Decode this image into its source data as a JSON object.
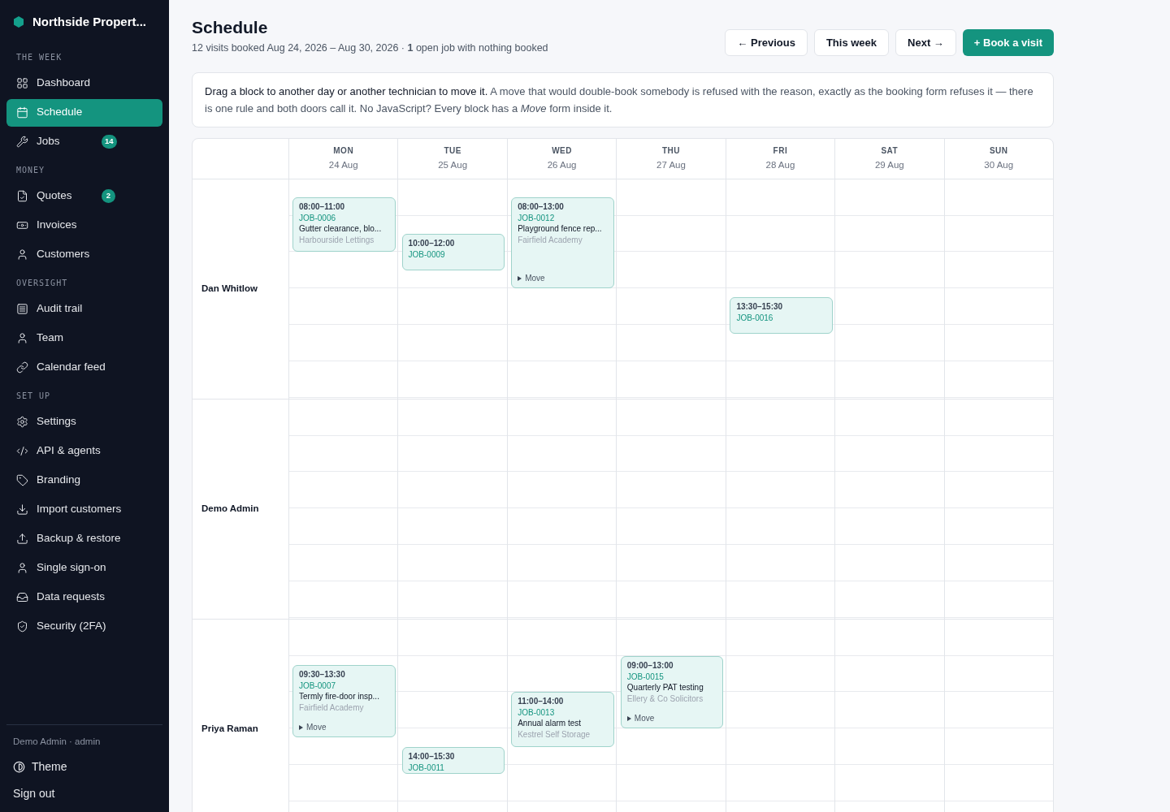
{
  "brand": "Northside Propert...",
  "sidebar": {
    "sections": [
      {
        "label": "THE WEEK",
        "items": [
          {
            "label": "Dashboard",
            "selected": false
          },
          {
            "label": "Schedule",
            "selected": true
          },
          {
            "label": "Jobs",
            "selected": false,
            "badge": "14"
          }
        ]
      },
      {
        "label": "MONEY",
        "items": [
          {
            "label": "Quotes",
            "selected": false,
            "badge": "2"
          },
          {
            "label": "Invoices",
            "selected": false
          },
          {
            "label": "Customers",
            "selected": false
          }
        ]
      },
      {
        "label": "OVERSIGHT",
        "items": [
          {
            "label": "Audit trail",
            "selected": false
          },
          {
            "label": "Team",
            "selected": false
          },
          {
            "label": "Calendar feed",
            "selected": false
          }
        ]
      },
      {
        "label": "SET UP",
        "items": [
          {
            "label": "Settings",
            "selected": false
          },
          {
            "label": "API & agents",
            "selected": false
          },
          {
            "label": "Branding",
            "selected": false
          },
          {
            "label": "Import customers",
            "selected": false
          },
          {
            "label": "Backup & restore",
            "selected": false
          },
          {
            "label": "Single sign-on",
            "selected": false
          },
          {
            "label": "Data requests",
            "selected": false
          },
          {
            "label": "Security (2FA)",
            "selected": false
          }
        ]
      }
    ],
    "user": "Demo Admin · admin",
    "theme": "Theme",
    "sign_out": "Sign out"
  },
  "page": {
    "title": "Schedule",
    "subtitle": "12 visits booked Aug 24, 2026 – Aug 30, 2026 · **1** open job with nothing booked",
    "buttons": [
      {
        "label": "← Previous",
        "kind": "plain"
      },
      {
        "label": "This week",
        "kind": "plain"
      },
      {
        "label": "Next →",
        "kind": "plain"
      },
      {
        "label": "+ Book a visit",
        "kind": "primary"
      }
    ]
  },
  "notice": {
    "lead": "Drag a block to another day or another technician to move it.",
    "body": "A move that would double-book somebody is refused with the reason, exactly as the booking form refuses it — there is one rule and both doors call it. No JavaScript? Every block has a *Move* form inside it."
  },
  "calendar": {
    "days": [
      {
        "name": "MON",
        "date": "24 Aug"
      },
      {
        "name": "TUE",
        "date": "25 Aug"
      },
      {
        "name": "WED",
        "date": "26 Aug"
      },
      {
        "name": "THU",
        "date": "27 Aug"
      },
      {
        "name": "FRI",
        "date": "28 Aug"
      },
      {
        "name": "SAT",
        "date": "29 Aug"
      },
      {
        "name": "SUN",
        "date": "30 Aug"
      }
    ],
    "technicians": [
      {
        "name": "Dan Whitlow",
        "days": [
          {
            "kind": "booked",
            "visits": [
              {
                "time": "08:00–11:00",
                "job": "JOB-0006",
                "title": "Gutter clearance, blo...",
                "customer": "Harbourside Lettings"
              }
            ]
          },
          {
            "kind": "booked",
            "visits": [
              {
                "time": "10:00–12:00",
                "job": "JOB-0009"
              }
            ]
          },
          {
            "kind": "booked",
            "visits": [
              {
                "time": "08:00–13:00",
                "job": "JOB-0012",
                "title": "Playground fence rep...",
                "customer": "Fairfield Academy",
                "move": "Move"
              }
            ]
          },
          {
            "kind": "empty"
          },
          {
            "kind": "booked",
            "visits": [
              {
                "time": "13:30–15:30",
                "job": "JOB-0016"
              }
            ]
          },
          {
            "kind": "empty"
          },
          {
            "kind": "empty"
          }
        ]
      },
      {
        "name": "Demo Admin"
      },
      {
        "name": "Priya Raman",
        "days": [
          {
            "kind": "booked",
            "visits": [
              {
                "time": "09:30–13:30",
                "job": "JOB-0007",
                "title": "Termly fire-door insp...",
                "customer": "Fairfield Academy",
                "move": "Move"
              }
            ]
          },
          {
            "kind": "booked",
            "visits": [
              {
                "time": "14:00–15:30",
                "job": "JOB-0011"
              }
            ]
          },
          {
            "kind": "booked",
            "visits": [
              {
                "time": "11:00–14:00",
                "job": "JOB-0013",
                "title": "Annual alarm test",
                "customer": "Kestrel Self Storage"
              }
            ]
          },
          {
            "kind": "booked",
            "visits": [
              {
                "time": "09:00–13:00",
                "job": "JOB-0015",
                "title": "Quarterly PAT testing",
                "customer": "Ellery & Co Solicitors",
                "move": "Move"
              }
            ]
          },
          {
            "kind": "empty"
          },
          {
            "kind": "empty"
          },
          {
            "kind": "empty"
          }
        ]
      }
    ]
  }
}
